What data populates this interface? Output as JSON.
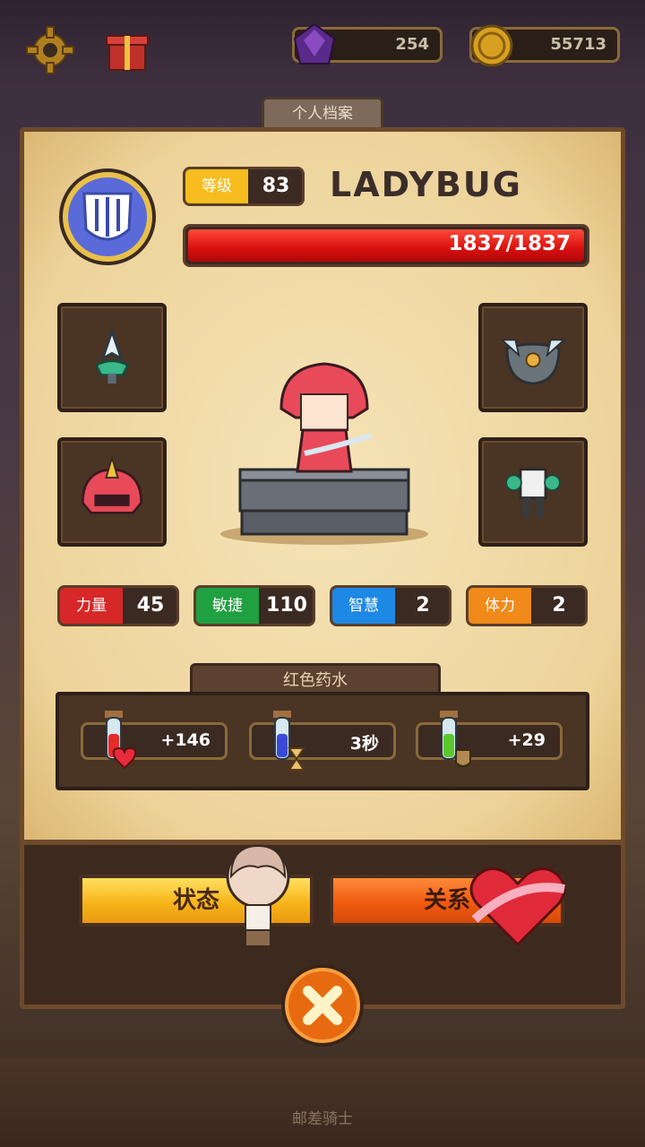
{
  "top": {
    "gems": "254",
    "gold": "55713"
  },
  "tab_title": "个人档案",
  "profile": {
    "level_label": "等级",
    "level": "83",
    "name": "LADYBUG",
    "hp_text": "1837/1837",
    "hp_fraction": 1.0
  },
  "stats": [
    {
      "label": "力量",
      "value": "45",
      "color": "#d62828"
    },
    {
      "label": "敏捷",
      "value": "110",
      "color": "#20a040"
    },
    {
      "label": "智慧",
      "value": "2",
      "color": "#1e88e5"
    },
    {
      "label": "体力",
      "value": "2",
      "color": "#f08a1a"
    }
  ],
  "potion": {
    "title": "红色药水",
    "items": [
      {
        "value": "+146",
        "icon": "red-potion-heart-icon"
      },
      {
        "value": "3秒",
        "icon": "blue-potion-hourglass-icon"
      },
      {
        "value": "+29",
        "icon": "green-potion-armor-icon"
      }
    ]
  },
  "buttons": {
    "status": "状态",
    "relation": "关系"
  },
  "footer": "邮差骑士",
  "colors": {
    "level_label_bg": "#f7bd1e",
    "hp_bar": "#d80f0f",
    "panel_bg": "#f2dca8"
  }
}
